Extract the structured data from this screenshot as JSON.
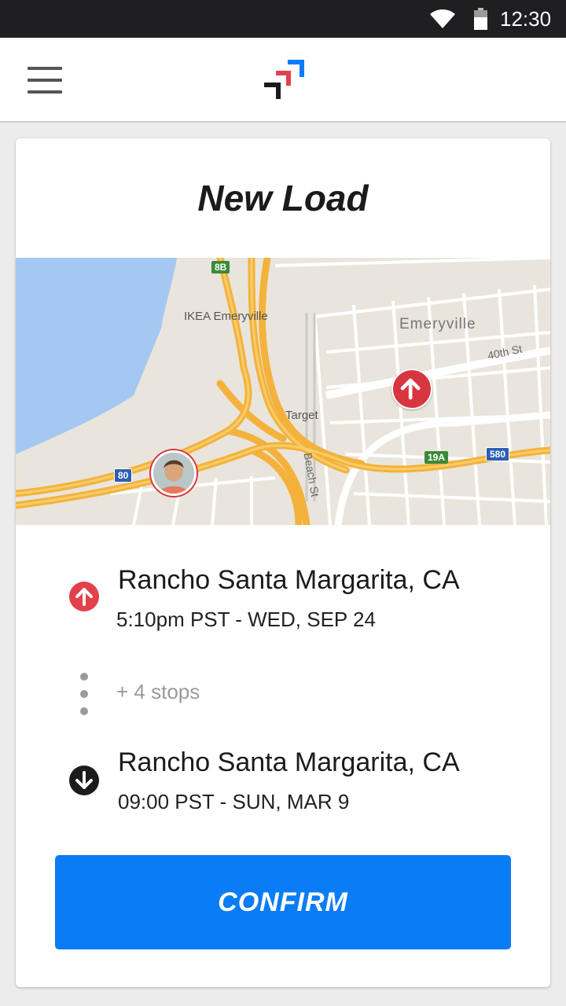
{
  "status_bar": {
    "time": "12:30",
    "wifi_icon": "wifi-icon",
    "battery_icon": "battery-icon"
  },
  "app_bar": {
    "menu_icon": "hamburger-menu-icon",
    "logo": "app-logo"
  },
  "card": {
    "title": "New Load",
    "map": {
      "labels": {
        "ikea": "IKEA Emeryville",
        "emeryville": "Emeryville",
        "street_40th": "40th St",
        "target": "Target",
        "beach_st": "Beach St"
      },
      "shields": {
        "i80": "80",
        "i580": "580",
        "r8b": "8B",
        "r19a": "19A"
      }
    },
    "pickup": {
      "icon": "pickup-arrow-up-icon",
      "city": "Rancho Santa Margarita, CA",
      "time": "5:10pm PST - WED, SEP 24"
    },
    "extra_stops": "+ 4 stops",
    "dropoff": {
      "icon": "dropoff-arrow-down-icon",
      "city": "Rancho Santa Margarita, CA",
      "time": "09:00 PST - SUN, MAR 9"
    },
    "confirm_label": "CONFIRM"
  },
  "colors": {
    "accent": "#0a7cf6",
    "pickup": "#e2414b",
    "dropoff": "#1b1b1b",
    "status_bar": "#1f1f22"
  }
}
